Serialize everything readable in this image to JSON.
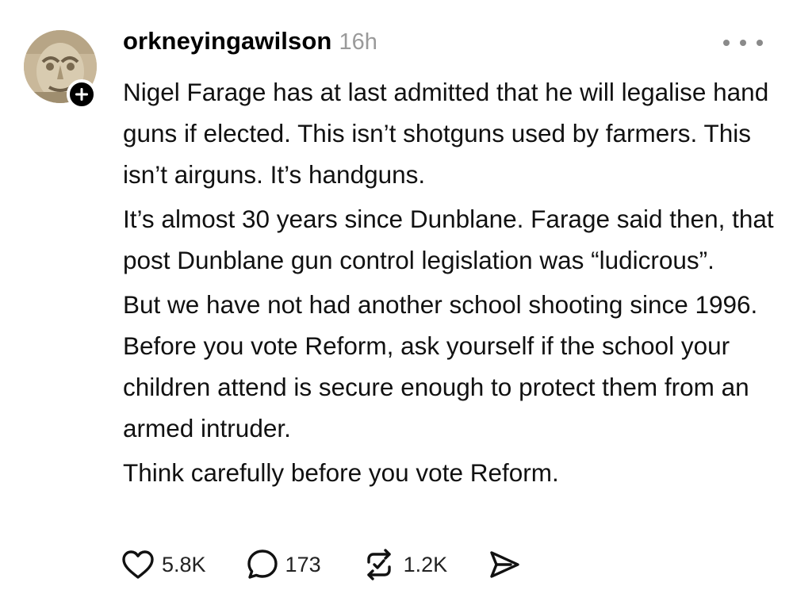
{
  "post": {
    "author": {
      "username": "orkneyingawilson",
      "avatar_icon": "stone-carving-avatar",
      "follow_icon": "plus-icon"
    },
    "timestamp": "16h",
    "more_icon": "more-icon",
    "paragraphs": [
      "Nigel Farage has at last admitted that he will legalise hand guns if elected. This isn’t shotguns used by farmers. This isn’t airguns. It’s handguns.",
      "It’s almost 30 years since Dunblane. Farage said then, that post Dunblane gun control legislation was “ludicrous”.",
      "But we have not had another school shooting since 1996. Before you vote Reform, ask yourself if the school your children attend is secure enough to protect them from an armed intruder.",
      "Think carefully before you vote Reform."
    ],
    "actions": {
      "likes": "5.8K",
      "replies": "173",
      "reposts": "1.2K",
      "like_icon": "heart-icon",
      "reply_icon": "speech-bubble-icon",
      "repost_icon": "repost-icon",
      "share_icon": "send-icon"
    }
  },
  "colors": {
    "text": "#111111",
    "timestamp": "#9a9a9a",
    "badge": "#000000"
  }
}
